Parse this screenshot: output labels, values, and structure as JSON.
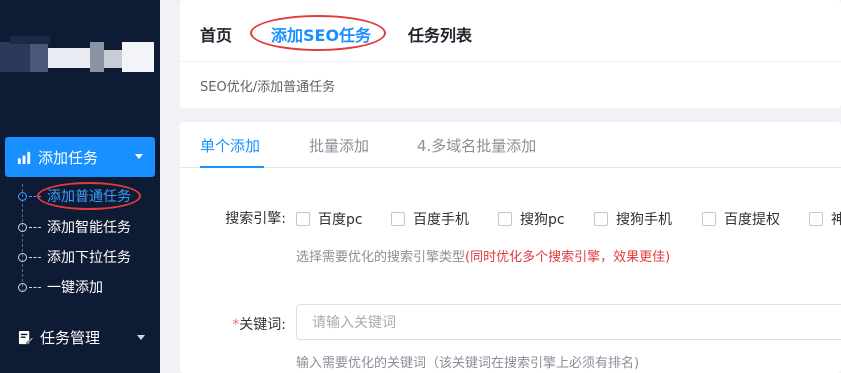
{
  "sidebar": {
    "menu_add_label": "添加任务",
    "sub_items": [
      {
        "label": "添加普通任务",
        "active": true
      },
      {
        "label": "添加智能任务",
        "active": false
      },
      {
        "label": "添加下拉任务",
        "active": false
      },
      {
        "label": "一键添加",
        "active": false
      }
    ],
    "menu_task_label": "任务管理"
  },
  "topnav": {
    "items": [
      "首页",
      "添加SEO任务",
      "任务列表"
    ],
    "active": "添加SEO任务"
  },
  "breadcrumb": "SEO优化/添加普通任务",
  "tabs": [
    "单个添加",
    "批量添加",
    "4.多域名批量添加"
  ],
  "form": {
    "engine_label": "搜索引擎:",
    "engines": [
      "百度pc",
      "百度手机",
      "搜狗pc",
      "搜狗手机",
      "百度提权",
      "神"
    ],
    "engine_hint": "选择需要优化的搜索引擎类型",
    "engine_hint_red": "(同时优化多个搜索引擎，效果更佳)",
    "keyword_required_mark": "*",
    "keyword_label": "关键词:",
    "keyword_placeholder": "请输入关键词",
    "keyword_hint": "输入需要优化的关键词（该关键词在搜索引擎上必须有排名)"
  },
  "colors": {
    "sidebar_bg": "#0e1b34",
    "accent": "#1890ff",
    "annotation_red": "#e23b3b"
  },
  "icons": {
    "menu_add": "chart-bar-icon",
    "menu_task": "edit-icon"
  }
}
